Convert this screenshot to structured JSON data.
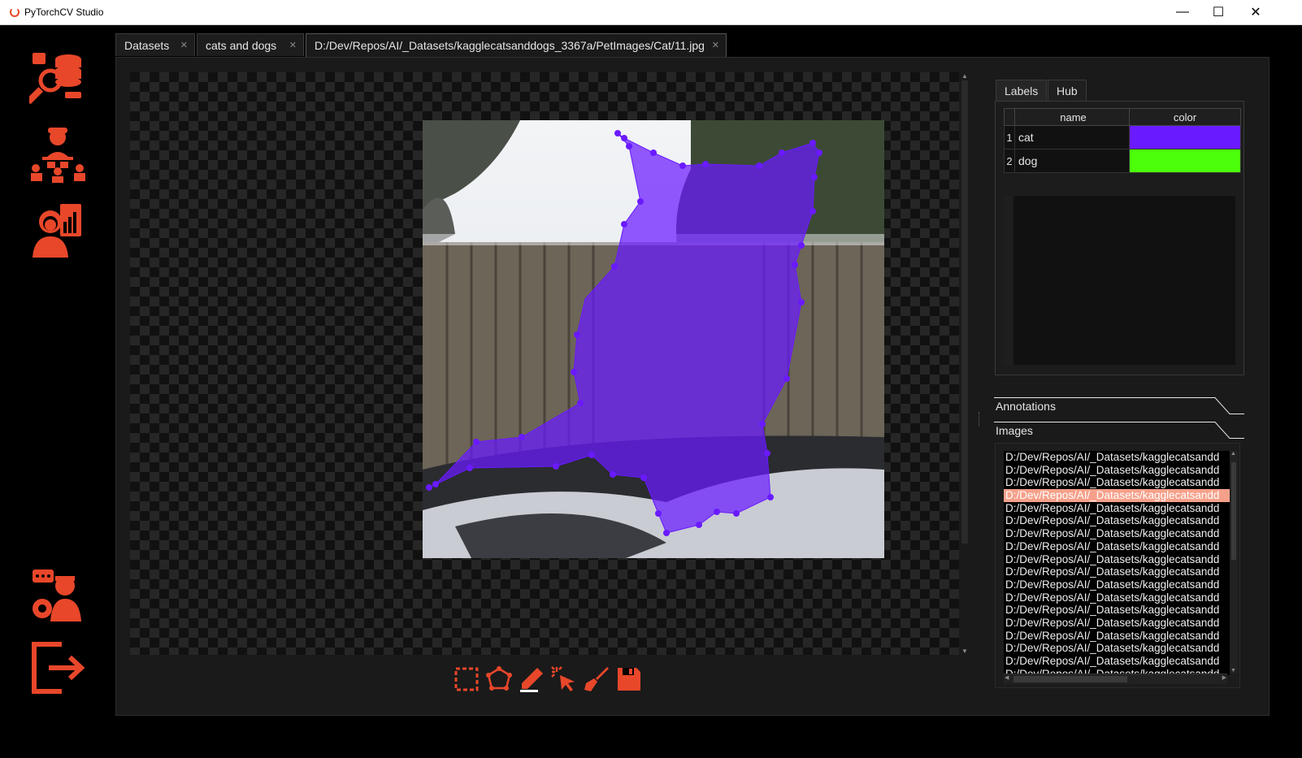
{
  "window": {
    "title": "PyTorchCV Studio",
    "minimize": "—",
    "maximize": "☐",
    "close": "✕"
  },
  "sidebar": {
    "items": [
      {
        "name": "datasets-search-icon"
      },
      {
        "name": "team-icon"
      },
      {
        "name": "analyst-report-icon"
      },
      {
        "name": "support-settings-icon"
      },
      {
        "name": "exit-icon"
      }
    ],
    "accent_color": "#e8472a"
  },
  "tabs": [
    {
      "label": "Datasets"
    },
    {
      "label": "cats and dogs"
    },
    {
      "label": "D:/Dev/Repos/AI/_Datasets/kagglecatsanddogs_3367a/PetImages/Cat/11.jpg"
    }
  ],
  "right_panel": {
    "tabs": [
      {
        "label": "Labels"
      },
      {
        "label": "Hub"
      }
    ],
    "labels_table": {
      "headers": [
        "name",
        "color"
      ],
      "rows": [
        {
          "index": "1",
          "name": "cat",
          "color": "#6a1aff"
        },
        {
          "index": "2",
          "name": "dog",
          "color": "#4cff0a"
        }
      ]
    },
    "annotations_title": "Annotations",
    "images_title": "Images",
    "images": [
      "D:/Dev/Repos/AI/_Datasets/kagglecatsandd",
      "D:/Dev/Repos/AI/_Datasets/kagglecatsandd",
      "D:/Dev/Repos/AI/_Datasets/kagglecatsandd",
      "D:/Dev/Repos/AI/_Datasets/kagglecatsandd",
      "D:/Dev/Repos/AI/_Datasets/kagglecatsandd",
      "D:/Dev/Repos/AI/_Datasets/kagglecatsandd",
      "D:/Dev/Repos/AI/_Datasets/kagglecatsandd",
      "D:/Dev/Repos/AI/_Datasets/kagglecatsandd",
      "D:/Dev/Repos/AI/_Datasets/kagglecatsandd",
      "D:/Dev/Repos/AI/_Datasets/kagglecatsandd",
      "D:/Dev/Repos/AI/_Datasets/kagglecatsandd",
      "D:/Dev/Repos/AI/_Datasets/kagglecatsandd",
      "D:/Dev/Repos/AI/_Datasets/kagglecatsandd",
      "D:/Dev/Repos/AI/_Datasets/kagglecatsandd",
      "D:/Dev/Repos/AI/_Datasets/kagglecatsandd",
      "D:/Dev/Repos/AI/_Datasets/kagglecatsandd",
      "D:/Dev/Repos/AI/_Datasets/kagglecatsandd",
      "D:/Dev/Repos/AI/_Datasets/kagglecatsandd"
    ],
    "selected_image_index": 3
  },
  "toolbar": {
    "tools": [
      "rectangle-select-icon",
      "polygon-icon",
      "pencil-icon",
      "magic-select-icon",
      "brush-icon",
      "save-icon"
    ]
  },
  "annotation": {
    "label": "cat",
    "color": "#6a1aff"
  }
}
